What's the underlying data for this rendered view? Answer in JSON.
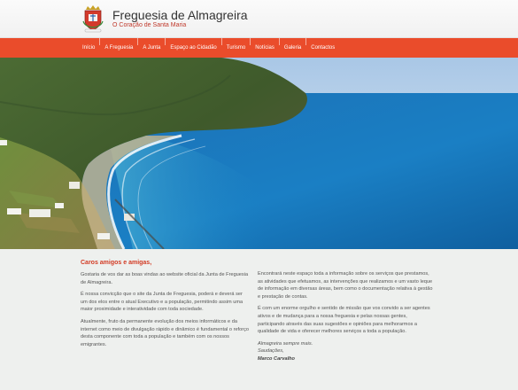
{
  "header": {
    "title": "Freguesia de Almagreira",
    "subtitle": "O Coração de Santa Maria",
    "logo_icon": "coat-of-arms-icon"
  },
  "nav": {
    "items": [
      {
        "label": "Início"
      },
      {
        "label": "A Freguesia"
      },
      {
        "label": "A Junta"
      },
      {
        "label": "Espaço ao Cidadão"
      },
      {
        "label": "Turismo"
      },
      {
        "label": "Notícias"
      },
      {
        "label": "Galeria"
      },
      {
        "label": "Contactos"
      }
    ]
  },
  "hero": {
    "image": "coastal-landscape-image"
  },
  "content": {
    "greeting": "Caros amigos e amigas,",
    "left_paragraphs": [
      "Gostaria de vos dar as boas vindas ao website oficial da Junta de Freguesia de Almagreira.",
      "É nossa convicção que o site da Junta de Freguesia, poderá e deverá ser um dos elos entre o atual Executivo e a população, permitindo assim uma maior proximidade e interatividade com toda sociedade.",
      "Atualmente, fruto da permanente evolução dos meios informáticos e da internet como meio de divulgação rápido e dinâmico é fundamental o reforço desta componente com toda a população e também com os nossos emigrantes."
    ],
    "right_paragraphs": [
      "Encontrará neste espaço toda a informação sobre os serviços que prestamos, as atividades que efetuamos, as intervenções que realizamos e um vasto leque de informação em diversas áreas, bem como o documentação relativa à gestão e prestação de contas.",
      "É com um enorme orgulho e sentido de missão que vos convido a ser agentes ativos e de mudança para a nossa freguesia e pelas nossas gentes, participando através das suas sugestões e opiniões para melhorarmos a qualidade de vida e oferecer melhores serviços a toda a população."
    ],
    "closing_1": "Almagreira sempre mais.",
    "closing_2": "Saudações,",
    "signature": "Marco Carvalho"
  },
  "colors": {
    "nav_background": "#ea4c2b",
    "accent_red": "#d23b24",
    "content_background": "#eef0ee",
    "ocean": "#1a7fc4"
  }
}
